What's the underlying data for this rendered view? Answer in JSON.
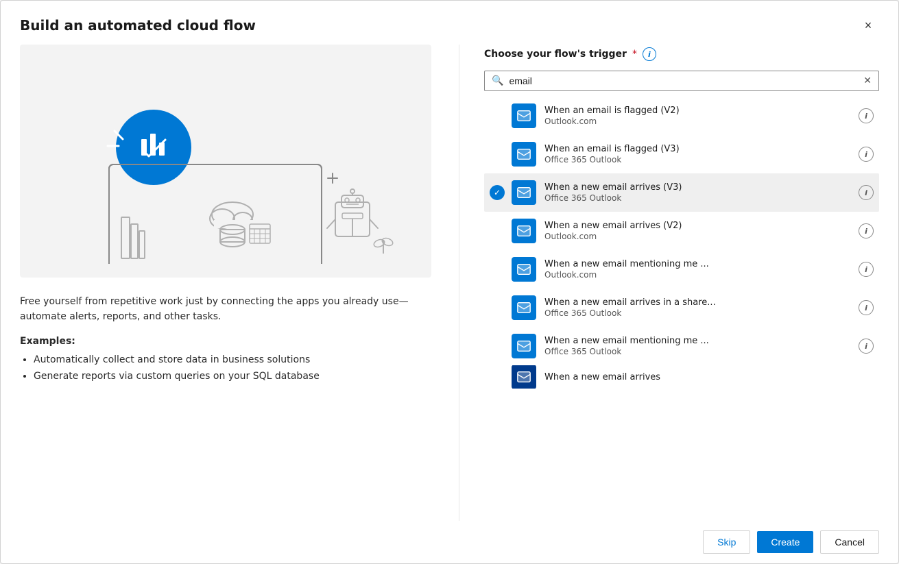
{
  "dialog": {
    "title": "Build an automated cloud flow",
    "close_label": "×"
  },
  "left_panel": {
    "description": "Free yourself from repetitive work just by connecting the apps you already use—automate alerts, reports, and other tasks.",
    "examples_label": "Examples:",
    "examples": [
      "Automatically collect and store data in business solutions",
      "Generate reports via custom queries on your SQL database"
    ]
  },
  "right_panel": {
    "trigger_label": "Choose your flow's trigger",
    "required_star": "*",
    "search_placeholder": "email",
    "search_value": "email",
    "triggers": [
      {
        "id": 1,
        "name": "When an email is flagged (V2)",
        "source": "Outlook.com",
        "selected": false
      },
      {
        "id": 2,
        "name": "When an email is flagged (V3)",
        "source": "Office 365 Outlook",
        "selected": false
      },
      {
        "id": 3,
        "name": "When a new email arrives (V3)",
        "source": "Office 365 Outlook",
        "selected": true
      },
      {
        "id": 4,
        "name": "When a new email arrives (V2)",
        "source": "Outlook.com",
        "selected": false
      },
      {
        "id": 5,
        "name": "When a new email mentioning me ...",
        "source": "Outlook.com",
        "selected": false
      },
      {
        "id": 6,
        "name": "When a new email arrives in a share...",
        "source": "Office 365 Outlook",
        "selected": false
      },
      {
        "id": 7,
        "name": "When a new email mentioning me ...",
        "source": "Office 365 Outlook",
        "selected": false
      }
    ],
    "partial_item_visible": true
  },
  "bottom_bar": {
    "skip_label": "Skip",
    "create_label": "Create",
    "cancel_label": "Cancel"
  }
}
